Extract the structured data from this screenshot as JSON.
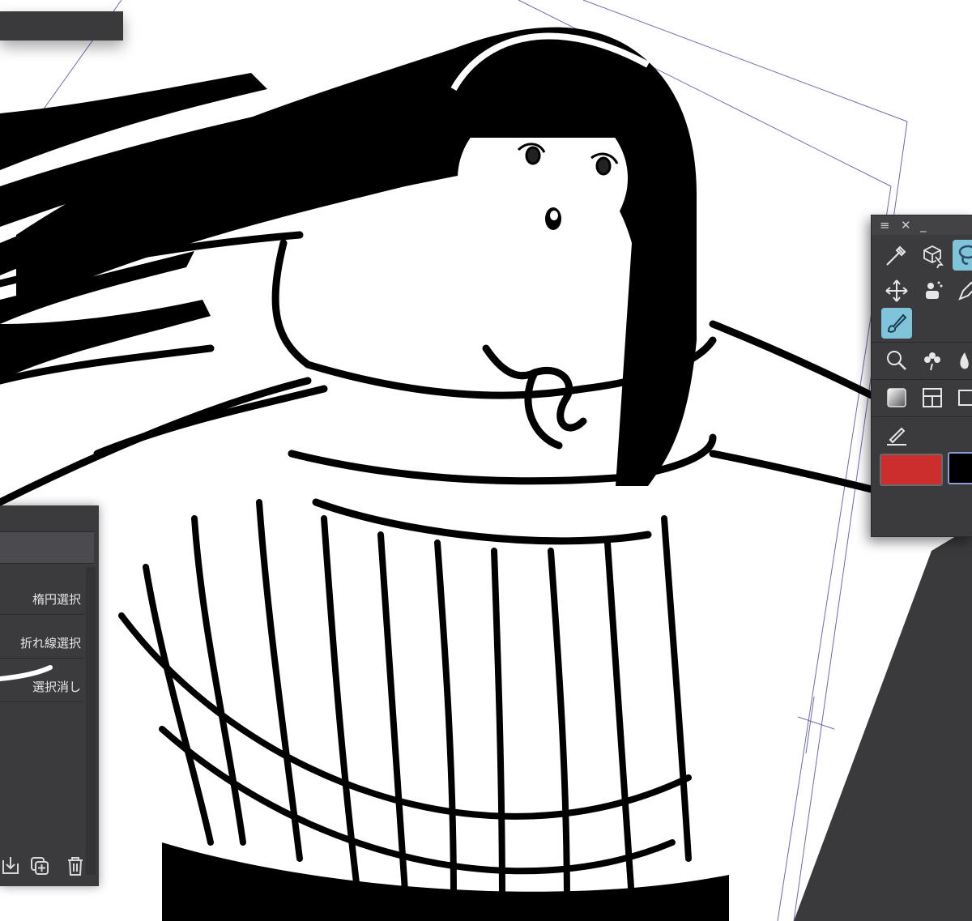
{
  "app": {
    "accent_color": "#7fc4d8",
    "panel_color": "#3b3b3e"
  },
  "subtool_panel": {
    "items": [
      {
        "label": "楕円選択",
        "icon": "ellipse-select-icon"
      },
      {
        "label": "折れ線選択",
        "icon": "polyline-select-icon"
      },
      {
        "label": "選択消し",
        "icon": "selection-eraser-icon"
      }
    ],
    "bottom_icons": [
      "import-icon",
      "duplicate-icon",
      "trash-icon"
    ]
  },
  "tool_palette": {
    "title_icons": [
      "menu-icon",
      "close-icon",
      "minimize-icon"
    ],
    "tools": [
      "eyedropper-icon",
      "3d-operation-icon",
      "lasso-icon",
      "move-icon",
      "fill-icon",
      "pen-icon",
      "brush-active-icon",
      "zoom-icon",
      "decoration-icon",
      "blend-icon",
      "gradient-icon",
      "frame-icon",
      "rectangle-icon",
      "correct-line-icon"
    ],
    "main_color": "#cc2e2e",
    "sub_color": "#000000"
  }
}
